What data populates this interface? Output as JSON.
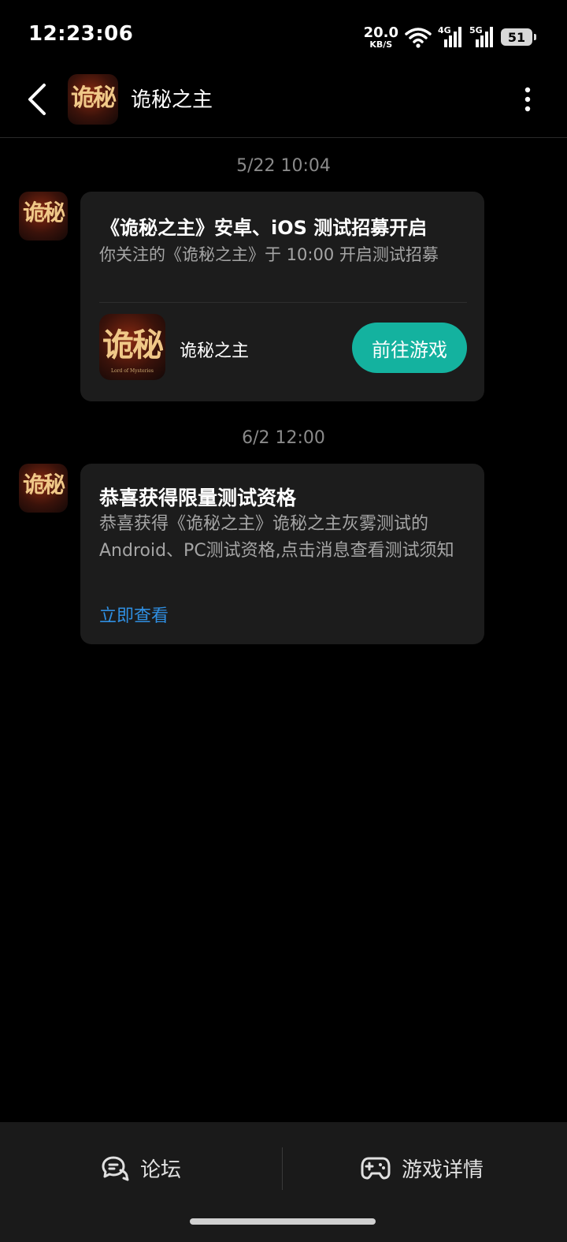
{
  "status_bar": {
    "time": "12:23:06",
    "net_speed": "20.0",
    "net_speed_unit": "KB/S",
    "sim1_label": "4G",
    "sim2_label": "5G",
    "battery": "51"
  },
  "header": {
    "title": "诡秘之主",
    "avatar_icon": "game-logo"
  },
  "logo": {
    "text": "诡秘",
    "subtitle": "Lord of Mysteries"
  },
  "messages": [
    {
      "timestamp": "5/22  10:04",
      "title": "《诡秘之主》安卓、iOS 测试招募开启",
      "body": "你关注的《诡秘之主》于 10:00 开启测试招募",
      "game_name": "诡秘之主",
      "button_label": "前往游戏"
    },
    {
      "timestamp": "6/2  12:00",
      "title": "恭喜获得限量测试资格",
      "body": "恭喜获得《诡秘之主》诡秘之主灰雾测试的Android、PC测试资格,点击消息查看测试须知",
      "link_label": "立即查看"
    }
  ],
  "bottom_nav": {
    "forum_label": "论坛",
    "details_label": "游戏详情"
  },
  "colors": {
    "accent_button": "#14b29f",
    "link": "#2f8ee0",
    "card_bg": "#1c1c1c"
  }
}
